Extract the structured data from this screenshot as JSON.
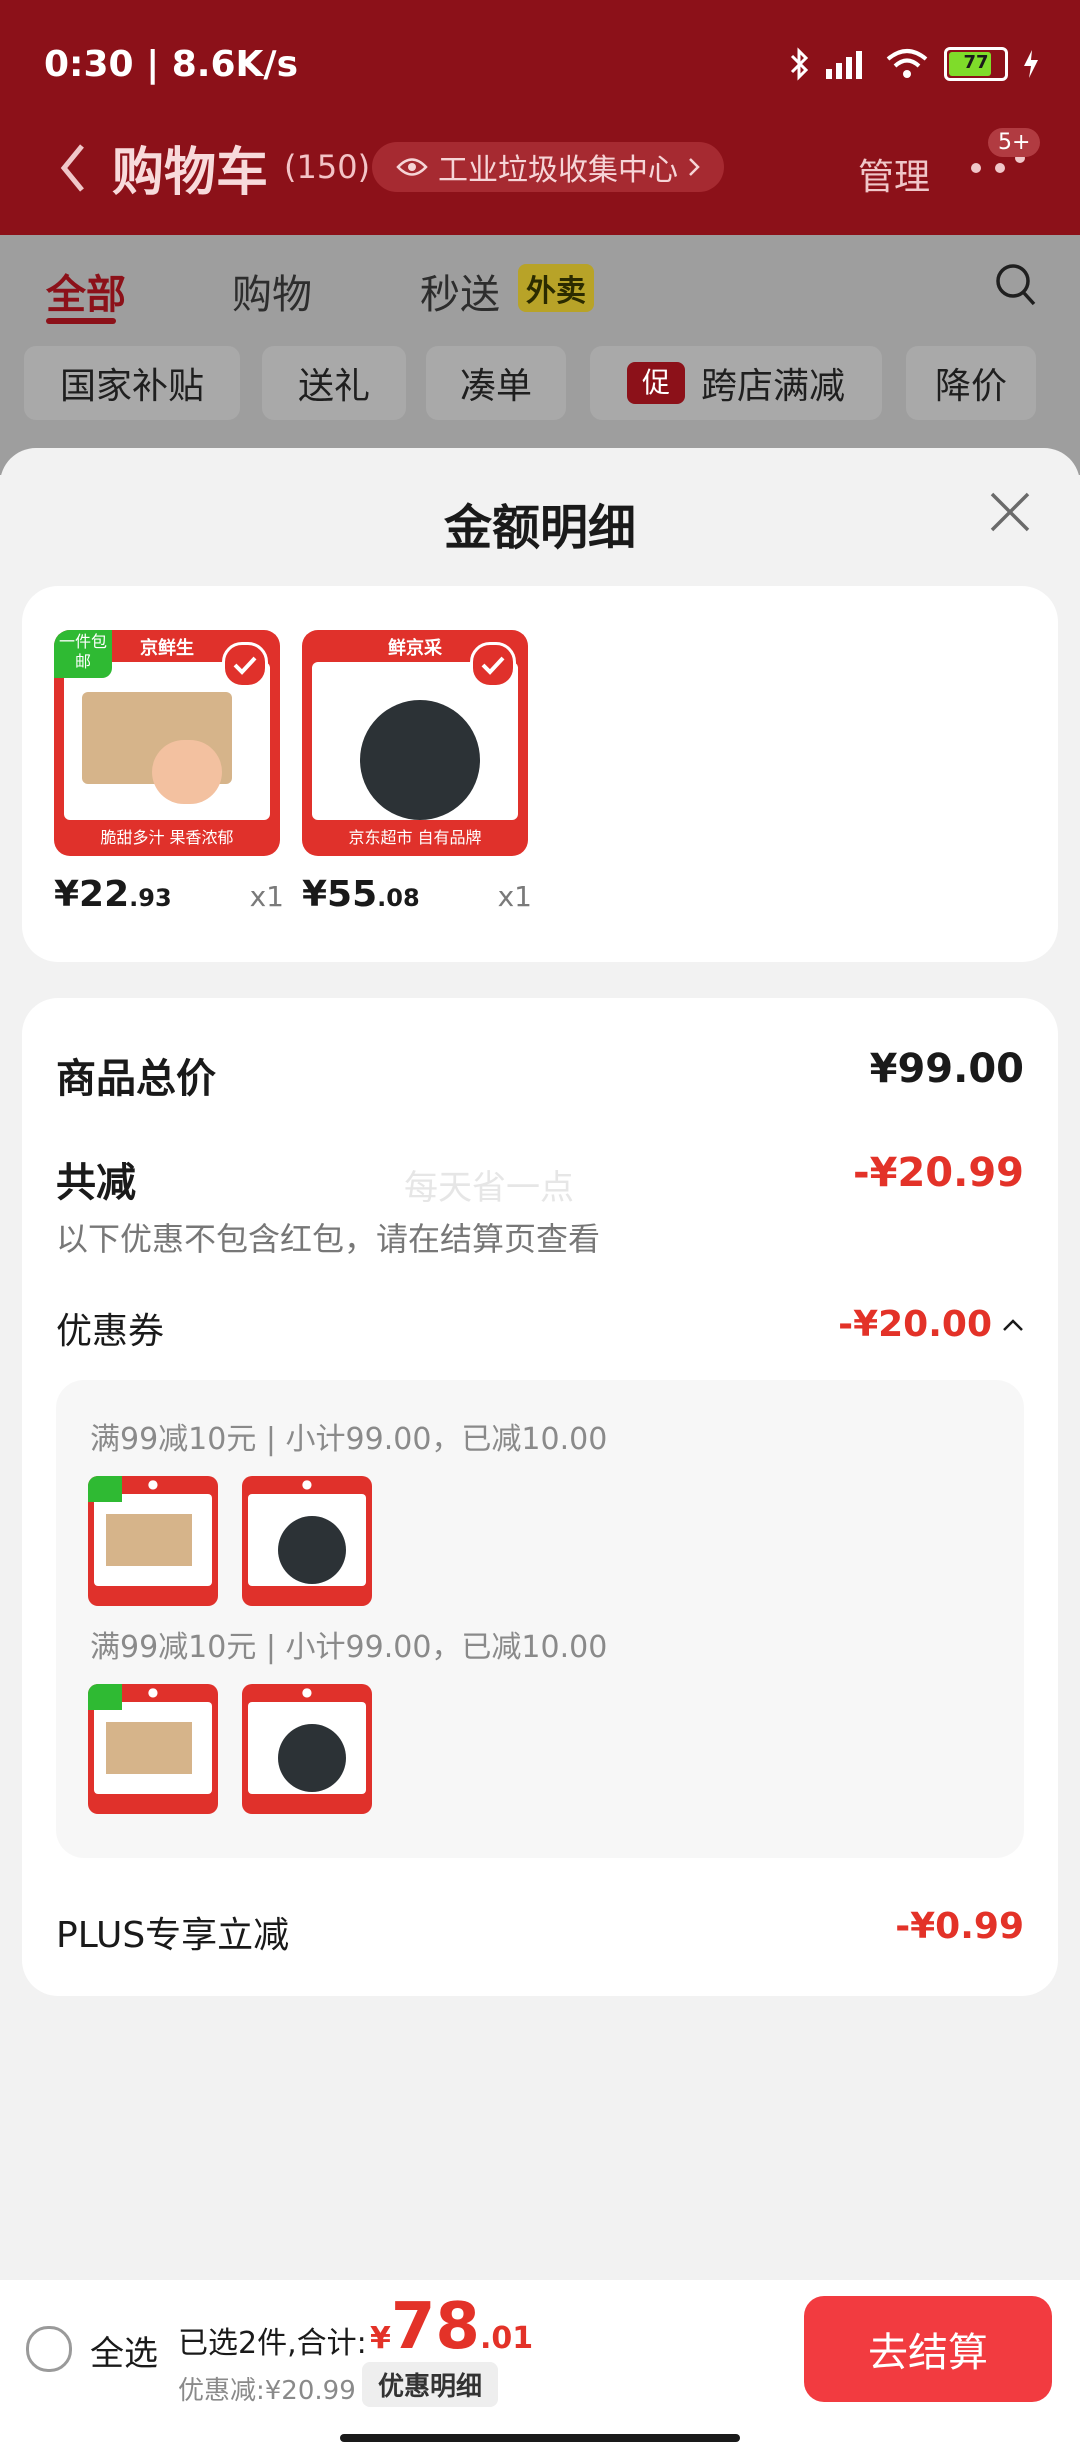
{
  "status": {
    "time": "0:30 | 8.6K/s",
    "battery": "77"
  },
  "header": {
    "title": "购物车",
    "count": "(150)",
    "location": "工业垃圾收集中心",
    "manage": "管理",
    "badge": "5+"
  },
  "tabs": [
    {
      "label": "全部"
    },
    {
      "label": "购物"
    },
    {
      "label": "秒送"
    }
  ],
  "tab_tag": "外卖",
  "chips": [
    {
      "label": "国家补贴"
    },
    {
      "label": "送礼"
    },
    {
      "label": "凑单"
    },
    {
      "label": "跨店满减"
    },
    {
      "label": "降价"
    }
  ],
  "promo_tag": "促",
  "sheet": {
    "title": "金额明细"
  },
  "products": [
    {
      "brand": "京鲜生",
      "corner": "一件包邮",
      "caption": "脆甜多汁 果香浓郁",
      "price_int": "¥22",
      "price_dec": ".93",
      "qty": "x1"
    },
    {
      "brand": "鲜京采",
      "caption": "京东超市 自有品牌",
      "price_int": "¥55",
      "price_dec": ".08",
      "qty": "x1"
    }
  ],
  "summary": {
    "total_label": "商品总价",
    "total_value": "¥99.00",
    "reduce_label": "共减",
    "reduce_value": "-¥20.99",
    "watermark": "每天省一点",
    "note": "以下优惠不包含红包，请在结算页查看",
    "coupon_label": "优惠券",
    "coupon_value": "-¥20.00",
    "coupon_lines": [
      "满99减10元 | 小计99.00，已减10.00",
      "满99减10元 | 小计99.00，已减10.00"
    ],
    "plus_label": "PLUS专享立减",
    "plus_value": "-¥0.99"
  },
  "bottom": {
    "select_all": "全选",
    "selected_text": "已选2件,合计:",
    "currency": "¥",
    "total_int": "78",
    "total_dec": ".01",
    "discount": "优惠减:¥20.99",
    "detail_button": "优惠明细",
    "checkout": "去结算"
  },
  "colors": {
    "brand_red": "#e33228",
    "header_red": "#8c1119",
    "checkout_red": "#f23b40"
  }
}
